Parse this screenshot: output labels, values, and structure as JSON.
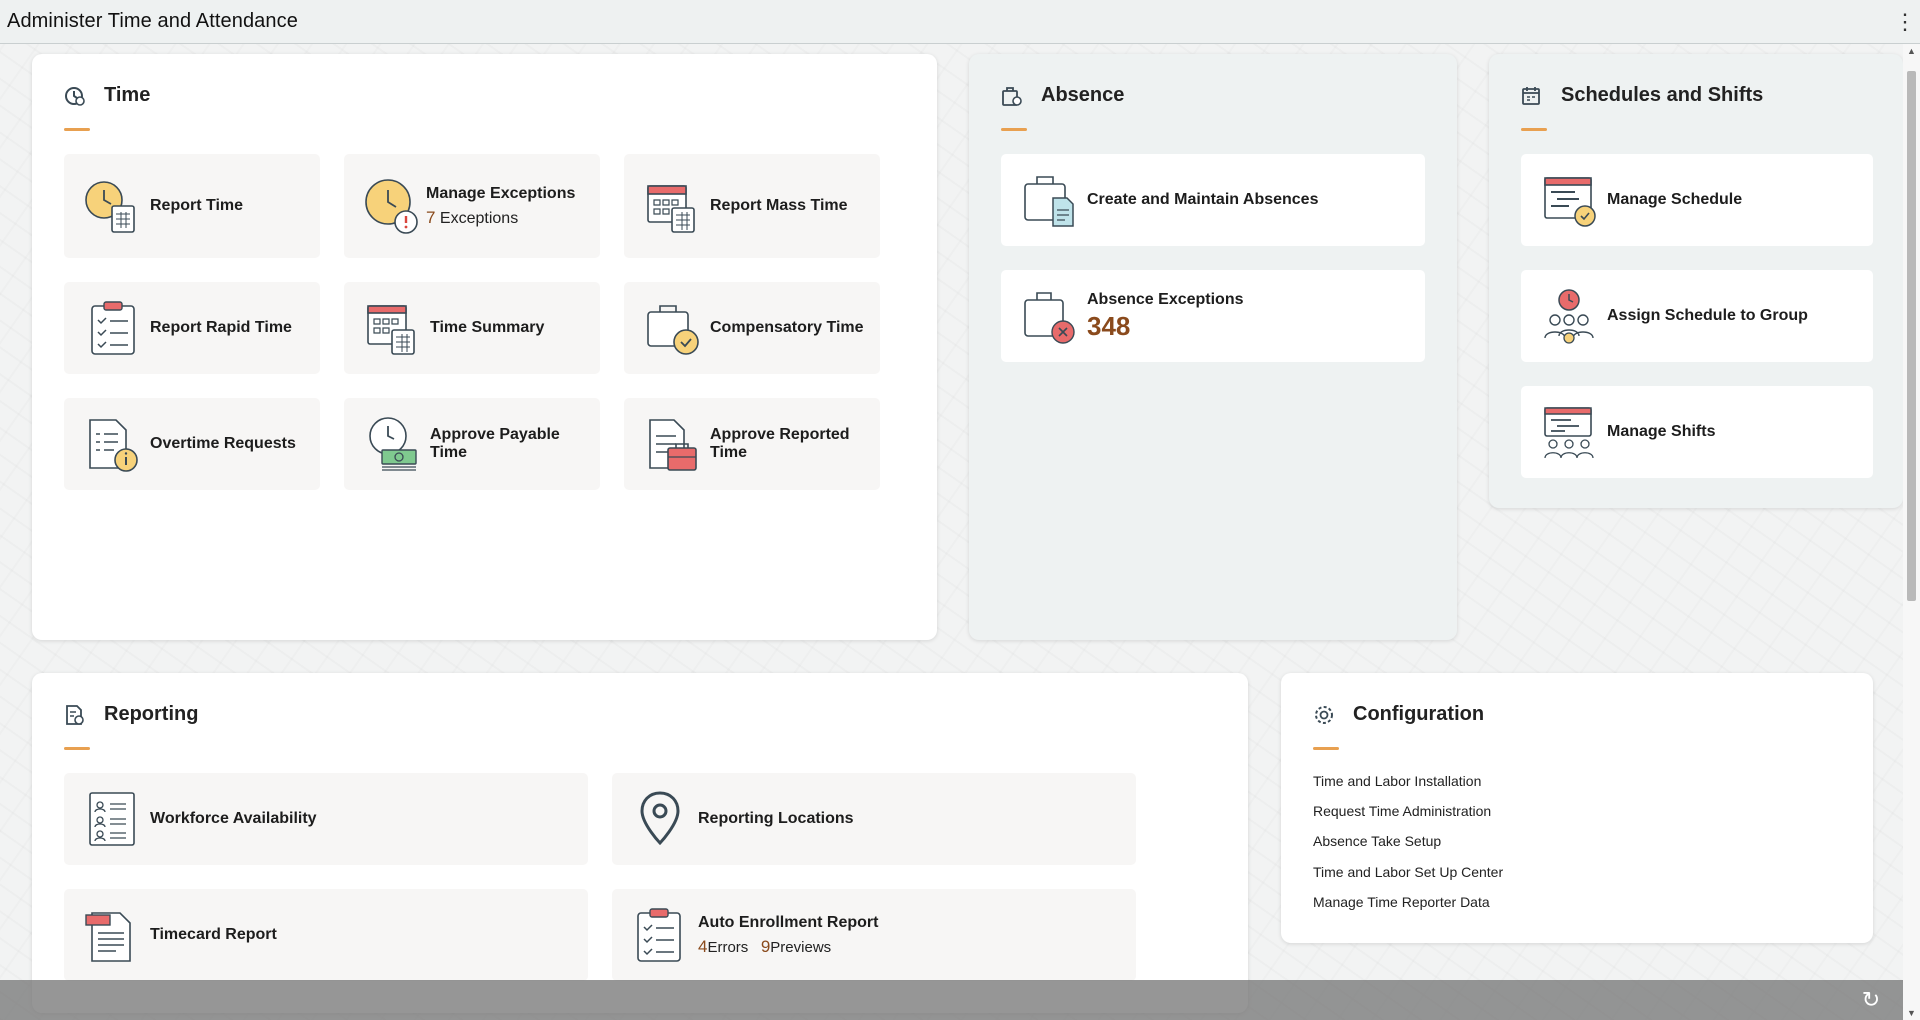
{
  "header": {
    "title": "Administer Time and Attendance",
    "menu_icon": "kebab-menu-icon"
  },
  "time": {
    "title": "Time",
    "tiles": [
      {
        "label": "Report Time"
      },
      {
        "label": "Manage Exceptions",
        "count": "7",
        "count_label": "Exceptions"
      },
      {
        "label": "Report Mass Time"
      },
      {
        "label": "Report Rapid Time"
      },
      {
        "label": "Time Summary"
      },
      {
        "label": "Compensatory Time"
      },
      {
        "label": "Overtime Requests"
      },
      {
        "label": "Approve Payable Time"
      },
      {
        "label": "Approve Reported Time"
      }
    ]
  },
  "absence": {
    "title": "Absence",
    "tiles": [
      {
        "label": "Create and Maintain Absences"
      },
      {
        "label": "Absence Exceptions",
        "count": "348"
      }
    ]
  },
  "schedules": {
    "title": "Schedules and Shifts",
    "tiles": [
      {
        "label": "Manage Schedule"
      },
      {
        "label": "Assign Schedule to Group"
      },
      {
        "label": "Manage Shifts"
      }
    ]
  },
  "reporting": {
    "title": "Reporting",
    "tiles": [
      {
        "label": "Workforce Availability"
      },
      {
        "label": "Reporting Locations"
      },
      {
        "label": "Timecard Report"
      },
      {
        "label": "Auto Enrollment Report",
        "errors": "4",
        "errors_label": "Errors",
        "previews": "9",
        "previews_label": "Previews"
      }
    ]
  },
  "configuration": {
    "title": "Configuration",
    "links": [
      "Time and Labor Installation",
      "Request Time Administration",
      "Absence Take Setup",
      "Time and Labor Set Up Center",
      "Manage Time Reporter Data"
    ]
  },
  "colors": {
    "accent": "#e8a050",
    "count": "#8a4a1c",
    "icon_stroke": "#3a4a55",
    "icon_fill_yellow": "#f7d27a",
    "icon_fill_red": "#e86b6b"
  }
}
